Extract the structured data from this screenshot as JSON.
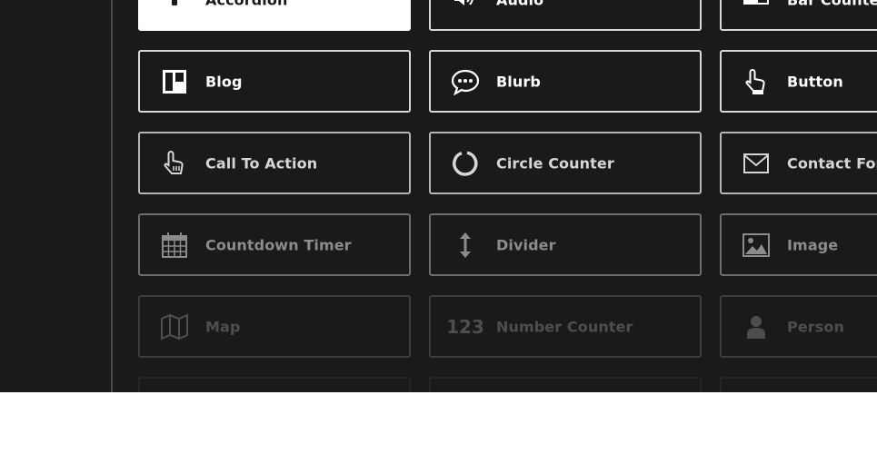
{
  "modules": [
    {
      "label": "Accordion",
      "icon": "accordion-icon"
    },
    {
      "label": "Audio",
      "icon": "audio-icon"
    },
    {
      "label": "Bar Counters",
      "icon": "bar-counters-icon"
    },
    {
      "label": "Blog",
      "icon": "blog-icon"
    },
    {
      "label": "Blurb",
      "icon": "blurb-icon"
    },
    {
      "label": "Button",
      "icon": "button-icon"
    },
    {
      "label": "Call To Action",
      "icon": "call-to-action-icon"
    },
    {
      "label": "Circle Counter",
      "icon": "circle-counter-icon"
    },
    {
      "label": "Contact Form",
      "icon": "contact-form-icon"
    },
    {
      "label": "Countdown Timer",
      "icon": "countdown-timer-icon"
    },
    {
      "label": "Divider",
      "icon": "divider-icon"
    },
    {
      "label": "Image",
      "icon": "image-icon"
    },
    {
      "label": "Map",
      "icon": "map-icon"
    },
    {
      "label": "Number Counter",
      "icon": "number-counter-icon",
      "icon_text": "123"
    },
    {
      "label": "Person",
      "icon": "person-icon"
    }
  ],
  "colors": {
    "panel": "#1a1a1a",
    "tile_border": "#d8d8d8",
    "active_tile": "#ffffff"
  }
}
